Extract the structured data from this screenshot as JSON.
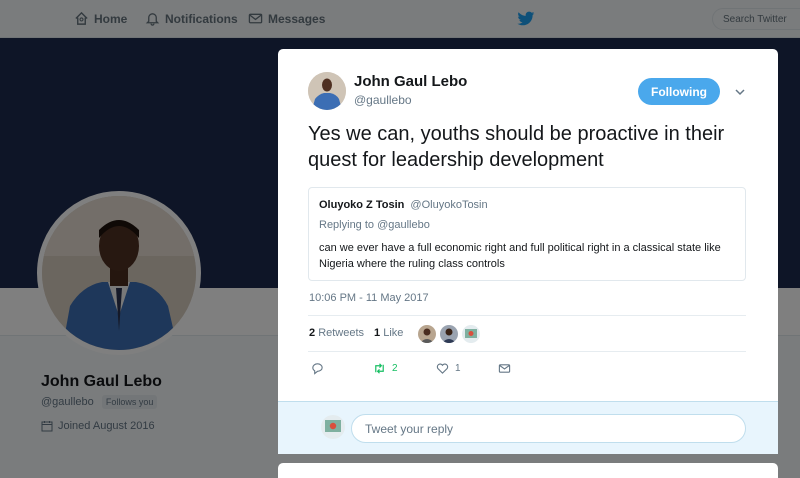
{
  "nav": {
    "home_label": "Home",
    "notifications_label": "Notifications",
    "messages_label": "Messages",
    "search_placeholder": "Search Twitter"
  },
  "profile": {
    "name": "John Gaul Lebo",
    "handle": "@gaullebo",
    "follows_you": "Follows you",
    "joined": "Joined August 2016"
  },
  "tweet": {
    "author_name": "John Gaul Lebo",
    "author_handle": "@gaullebo",
    "follow_label": "Following",
    "text": "Yes we can, youths should be proactive in their quest for leadership development",
    "quote": {
      "name": "Oluyoko Z Tosin",
      "handle": "@OluyokoTosin",
      "replying_to": "Replying to @gaullebo",
      "text": "can we ever have a full economic right and full political right in a classical state like Nigeria where the ruling class controls"
    },
    "timestamp": "10:06 PM - 11 May 2017",
    "retweets_count": "2",
    "retweets_label": "Retweets",
    "likes_count": "1",
    "likes_label": "Like",
    "action_retweet_count": "2",
    "action_like_count": "1"
  },
  "reply": {
    "placeholder": "Tweet your reply"
  },
  "colors": {
    "accent": "#4aa8ec",
    "banner": "#1c2a4e",
    "retweet_green": "#17bf63"
  }
}
